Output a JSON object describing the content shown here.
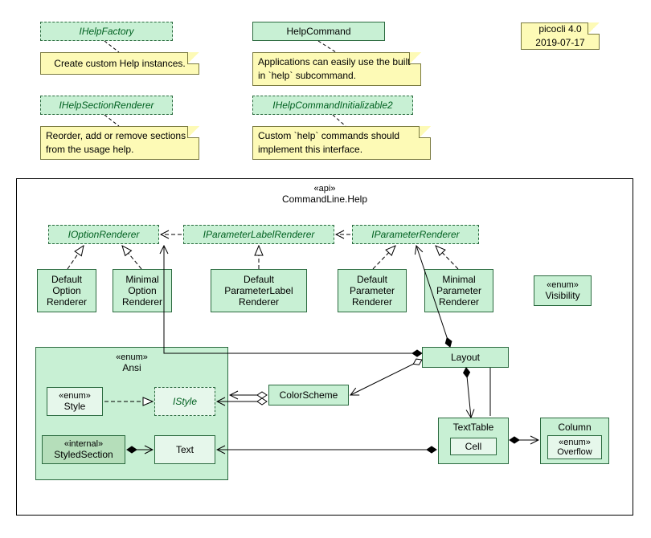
{
  "noteVersion": {
    "line1": "picocli 4.0",
    "line2": "2019-07-17"
  },
  "top": {
    "ihelpFactory": "IHelpFactory",
    "ihelpFactoryNote": "Create custom Help instances.",
    "helpCommand": "HelpCommand",
    "helpCommandNote": "Applications can easily use the built-in `help` subcommand.",
    "ihelpSectionRenderer": "IHelpSectionRenderer",
    "ihelpSectionRendererNote": "Reorder, add or remove sections from the usage help.",
    "ihelpCommandInit2": "IHelpCommandInitializable2",
    "ihelpCommandInit2Note": "Custom `help` commands should implement this interface."
  },
  "pkg": {
    "stereotype": "«api»",
    "title": "CommandLine.Help"
  },
  "interfaces": {
    "ioptionRenderer": "IOptionRenderer",
    "iparamLabelRenderer": "IParameterLabelRenderer",
    "iparamRenderer": "IParameterRenderer"
  },
  "classes": {
    "defaultOptionRenderer": {
      "l1": "Default",
      "l2": "Option",
      "l3": "Renderer"
    },
    "minimalOptionRenderer": {
      "l1": "Minimal",
      "l2": "Option",
      "l3": "Renderer"
    },
    "defaultParamLabelRenderer": {
      "l1": "Default",
      "l2": "ParameterLabel",
      "l3": "Renderer"
    },
    "defaultParamRenderer": {
      "l1": "Default",
      "l2": "Parameter",
      "l3": "Renderer"
    },
    "minimalParamRenderer": {
      "l1": "Minimal",
      "l2": "Parameter",
      "l3": "Renderer"
    },
    "visibility": {
      "stereotype": "«enum»",
      "name": "Visibility"
    },
    "layout": "Layout",
    "colorScheme": "ColorScheme",
    "textTable": "TextTable",
    "cell": "Cell",
    "column": "Column",
    "overflow": {
      "stereotype": "«enum»",
      "name": "Overflow"
    }
  },
  "ansi": {
    "stereotype": "«enum»",
    "name": "Ansi",
    "style": {
      "stereotype": "«enum»",
      "name": "Style"
    },
    "istyle": "IStyle",
    "styledSection": {
      "stereotype": "«internal»",
      "name": "StyledSection"
    },
    "text": "Text"
  }
}
